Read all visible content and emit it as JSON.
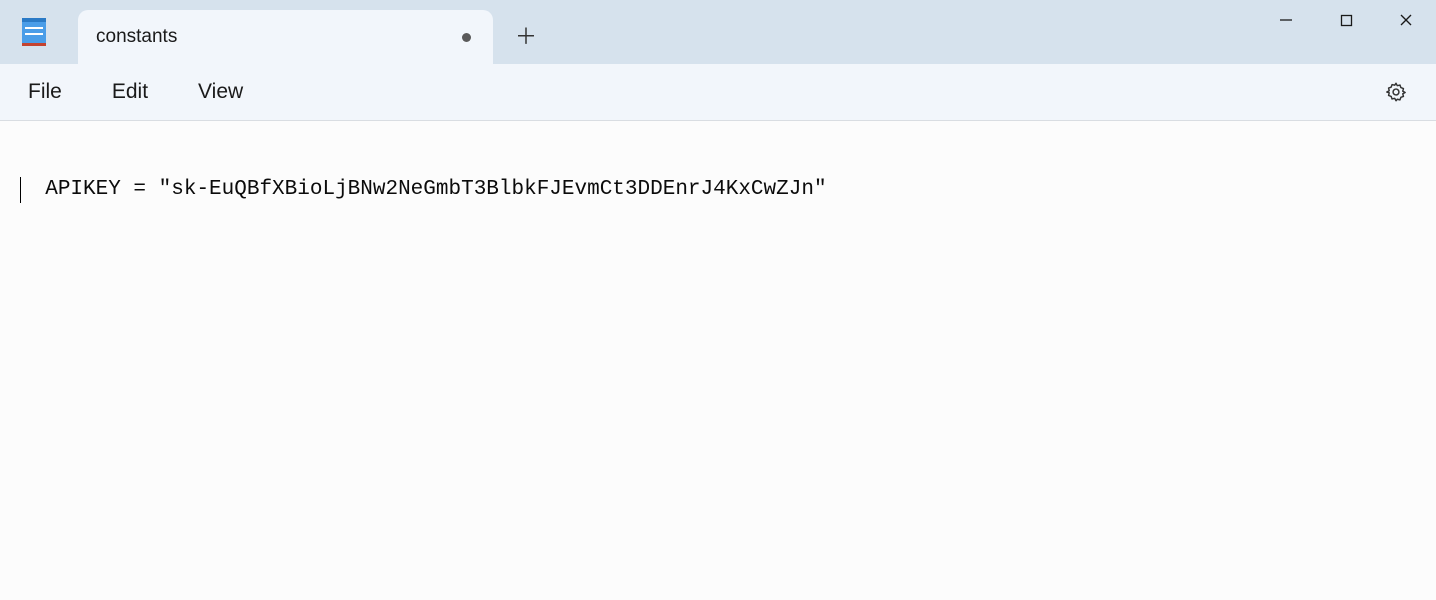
{
  "tab": {
    "title": "constants",
    "modified": true
  },
  "menubar": {
    "file": "File",
    "edit": "Edit",
    "view": "View"
  },
  "editor": {
    "content": "APIKEY = \"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\""
  }
}
